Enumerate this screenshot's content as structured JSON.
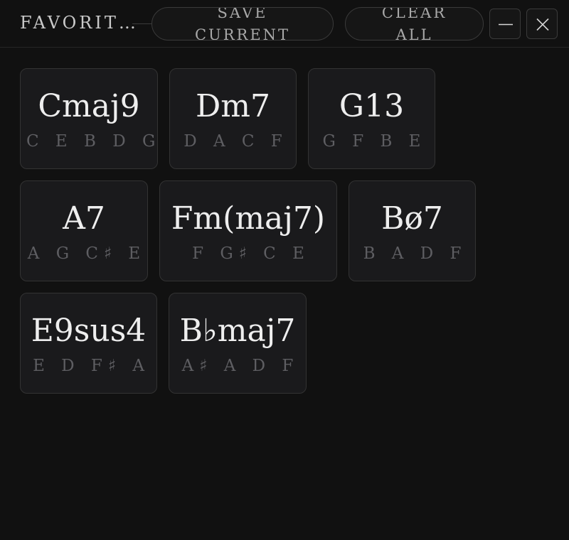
{
  "header": {
    "title": "FAVORIT…",
    "save_label": "SAVE CURRENT",
    "clear_label": "CLEAR ALL",
    "minimize_icon": "minus-icon",
    "close_icon": "close-icon"
  },
  "chords": [
    {
      "name": "Cmaj9",
      "notes": "C E B D G"
    },
    {
      "name": "Dm7",
      "notes": "D A C F"
    },
    {
      "name": "G13",
      "notes": "G F B E"
    },
    {
      "name": "A7",
      "notes": "A G C♯ E"
    },
    {
      "name": "Fm(maj7)",
      "notes": "F G♯ C E"
    },
    {
      "name": "Bø7",
      "notes": "B A D F"
    },
    {
      "name": "E9sus4",
      "notes": "E D F♯ A"
    },
    {
      "name": "B♭maj7",
      "notes": "A♯ A D F"
    }
  ],
  "colors": {
    "background": "#111111",
    "card": "#1a1a1c",
    "border": "#333333",
    "chord_text": "#eeeeee",
    "notes_text": "#5e5e62"
  }
}
